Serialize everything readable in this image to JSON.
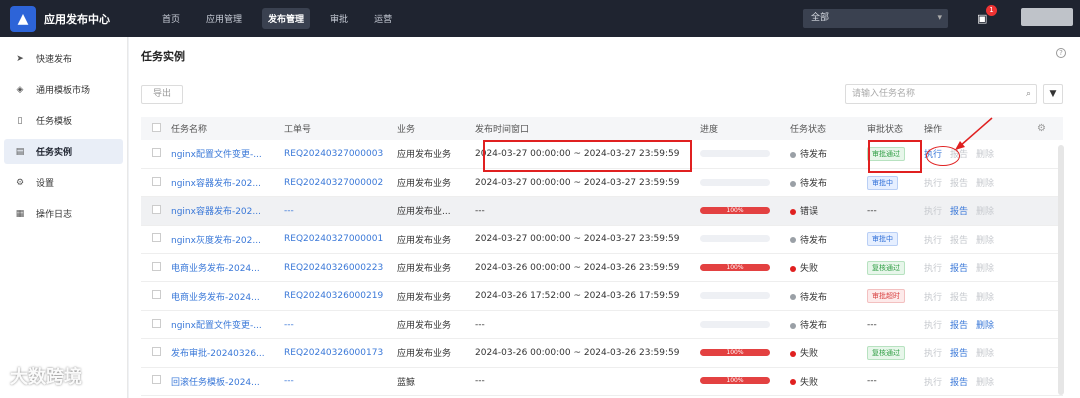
{
  "header": {
    "app_title": "应用发布中心",
    "nav": [
      "首页",
      "应用管理",
      "发布管理",
      "审批",
      "运营"
    ],
    "active_nav": 2,
    "scope_select": "全部",
    "notification_count": "1"
  },
  "sidebar": {
    "items": [
      {
        "label": "快速发布",
        "icon": "send-icon"
      },
      {
        "label": "通用模板市场",
        "icon": "layers-icon"
      },
      {
        "label": "任务模板",
        "icon": "clipboard-icon"
      },
      {
        "label": "任务实例",
        "icon": "document-icon"
      },
      {
        "label": "设置",
        "icon": "gear-icon"
      },
      {
        "label": "操作日志",
        "icon": "log-icon"
      }
    ],
    "active_index": 3
  },
  "main": {
    "title": "任务实例",
    "export_label": "导出",
    "search_placeholder": "请输入任务名称",
    "columns": [
      "任务名称",
      "工单号",
      "业务",
      "发布时间窗口",
      "进度",
      "任务状态",
      "审批状态",
      "操作"
    ],
    "ops": [
      "执行",
      "报告",
      "删除"
    ],
    "rows": [
      {
        "name": "nginx配置文件变更-...",
        "ticket": "REQ20240327000003",
        "biz": "应用发布业务",
        "window": "2024-03-27 00:00:00 ~ 2024-03-27 23:59:59",
        "progress": null,
        "progress_text": "",
        "status": "待发布",
        "status_color": "#9aa0a6",
        "approval": "审批通过",
        "approval_color": "green",
        "ops": [
          true,
          false,
          false
        ],
        "shade": false
      },
      {
        "name": "nginx容器发布-202...",
        "ticket": "REQ20240327000002",
        "biz": "应用发布业务",
        "window": "2024-03-27 00:00:00 ~ 2024-03-27 23:59:59",
        "progress": null,
        "progress_text": "",
        "status": "待发布",
        "status_color": "#9aa0a6",
        "approval": "审批中",
        "approval_color": "blue",
        "ops": [
          false,
          false,
          false
        ],
        "shade": false
      },
      {
        "name": "nginx容器发布-202...",
        "ticket": "---",
        "biz": "应用发布业...",
        "window": "---",
        "progress": 1.0,
        "progress_text": "100%",
        "status": "错误",
        "status_color": "#e02020",
        "approval": "---",
        "approval_color": "",
        "ops": [
          false,
          true,
          false
        ],
        "shade": true
      },
      {
        "name": "nginx灰度发布-202...",
        "ticket": "REQ20240327000001",
        "biz": "应用发布业务",
        "window": "2024-03-27 00:00:00 ~ 2024-03-27 23:59:59",
        "progress": null,
        "progress_text": "",
        "status": "待发布",
        "status_color": "#9aa0a6",
        "approval": "审批中",
        "approval_color": "blue",
        "ops": [
          false,
          false,
          false
        ],
        "shade": false
      },
      {
        "name": "电商业务发布-2024...",
        "ticket": "REQ20240326000223",
        "biz": "应用发布业务",
        "window": "2024-03-26 00:00:00 ~ 2024-03-26 23:59:59",
        "progress": 1.0,
        "progress_text": "100%",
        "status": "失败",
        "status_color": "#e02020",
        "approval": "复核通过",
        "approval_color": "green",
        "ops": [
          false,
          true,
          false
        ],
        "shade": false
      },
      {
        "name": "电商业务发布-2024...",
        "ticket": "REQ20240326000219",
        "biz": "应用发布业务",
        "window": "2024-03-26 17:52:00 ~ 2024-03-26 17:59:59",
        "progress": null,
        "progress_text": "",
        "status": "待发布",
        "status_color": "#9aa0a6",
        "approval": "审批超时",
        "approval_color": "red",
        "ops": [
          false,
          false,
          false
        ],
        "shade": false
      },
      {
        "name": "nginx配置文件变更-...",
        "ticket": "---",
        "biz": "应用发布业务",
        "window": "---",
        "progress": null,
        "progress_text": "",
        "status": "待发布",
        "status_color": "#9aa0a6",
        "approval": "---",
        "approval_color": "",
        "ops": [
          false,
          true,
          true
        ],
        "shade": false
      },
      {
        "name": "发布审批-20240326...",
        "ticket": "REQ20240326000173",
        "biz": "应用发布业务",
        "window": "2024-03-26 00:00:00 ~ 2024-03-26 23:59:59",
        "progress": 1.0,
        "progress_text": "100%",
        "status": "失败",
        "status_color": "#e02020",
        "approval": "复核通过",
        "approval_color": "green",
        "ops": [
          false,
          true,
          false
        ],
        "shade": false
      },
      {
        "name": "回滚任务模板-2024...",
        "ticket": "---",
        "biz": "蓝鲸",
        "window": "---",
        "progress": 1.0,
        "progress_text": "100%",
        "status": "失败",
        "status_color": "#e02020",
        "approval": "---",
        "approval_color": "",
        "ops": [
          false,
          true,
          false
        ],
        "shade": false
      }
    ]
  },
  "watermark": "大数跨境"
}
